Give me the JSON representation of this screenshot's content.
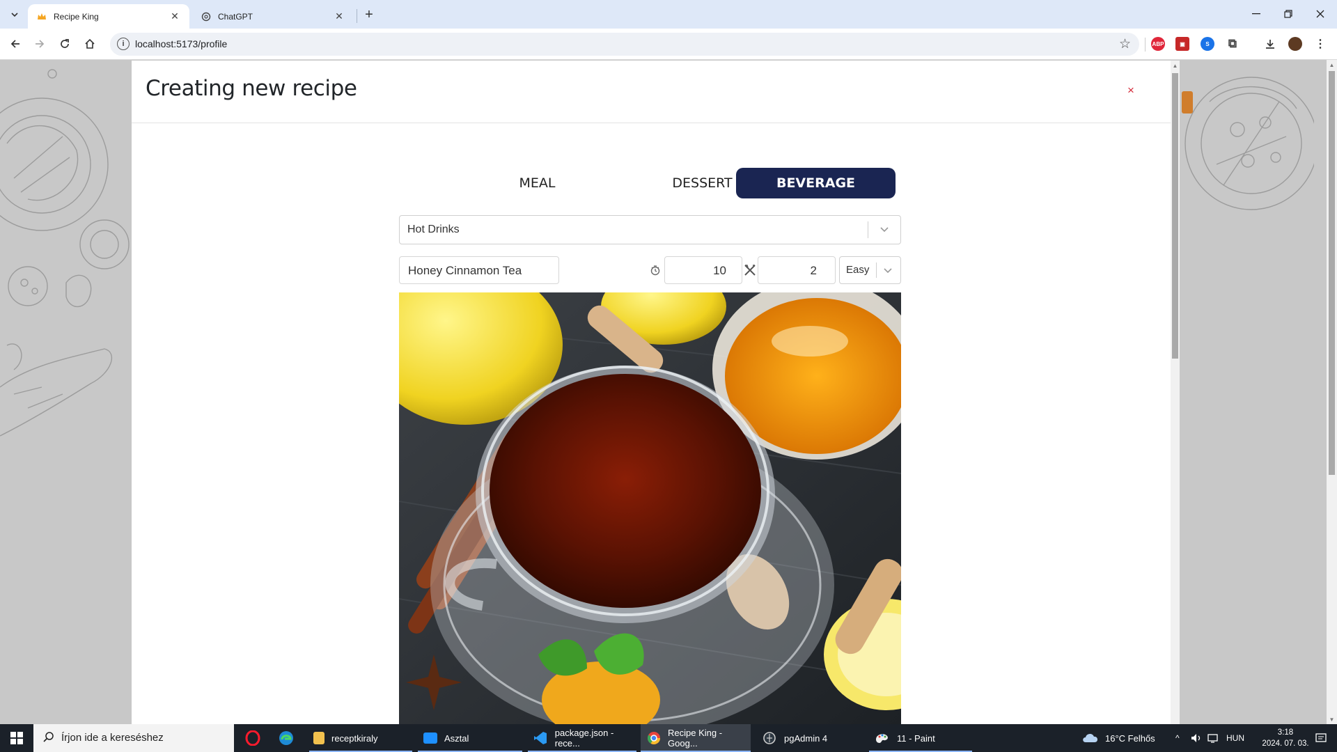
{
  "browser": {
    "tabs": [
      {
        "title": "Recipe King",
        "favicon": "crown-icon",
        "active": true
      },
      {
        "title": "ChatGPT",
        "favicon": "chatgpt-icon",
        "active": false
      }
    ],
    "url": "localhost:5173/profile"
  },
  "modal": {
    "title": "Creating new recipe",
    "close_label": "×",
    "types": [
      {
        "label": "MEAL",
        "active": false
      },
      {
        "label": "DESSERT",
        "active": false
      },
      {
        "label": "BEVERAGE",
        "active": true
      }
    ],
    "category": {
      "value": "Hot Drinks"
    },
    "recipe_name": "Honey Cinnamon Tea",
    "prep_time": "10",
    "servings": "2",
    "difficulty": "Easy"
  },
  "taskbar": {
    "search_placeholder": "Írjon ide a kereséshez",
    "apps": [
      {
        "label": "receptkiraly",
        "icon": "folder-icon"
      },
      {
        "label": "Asztal",
        "icon": "desktop-icon"
      },
      {
        "label": "package.json - rece...",
        "icon": "vscode-icon"
      },
      {
        "label": "Recipe King - Goog...",
        "icon": "chrome-icon"
      },
      {
        "label": "pgAdmin 4",
        "icon": "pgadmin-icon"
      },
      {
        "label": "11 - Paint",
        "icon": "paint-icon"
      }
    ],
    "weather": "16°C  Felhős",
    "language": "HUN",
    "time": "3:18",
    "date": "2024. 07. 03."
  },
  "colors": {
    "accent": "#1a2552",
    "close": "#d42b3a",
    "taskbar": "#1b2129"
  }
}
